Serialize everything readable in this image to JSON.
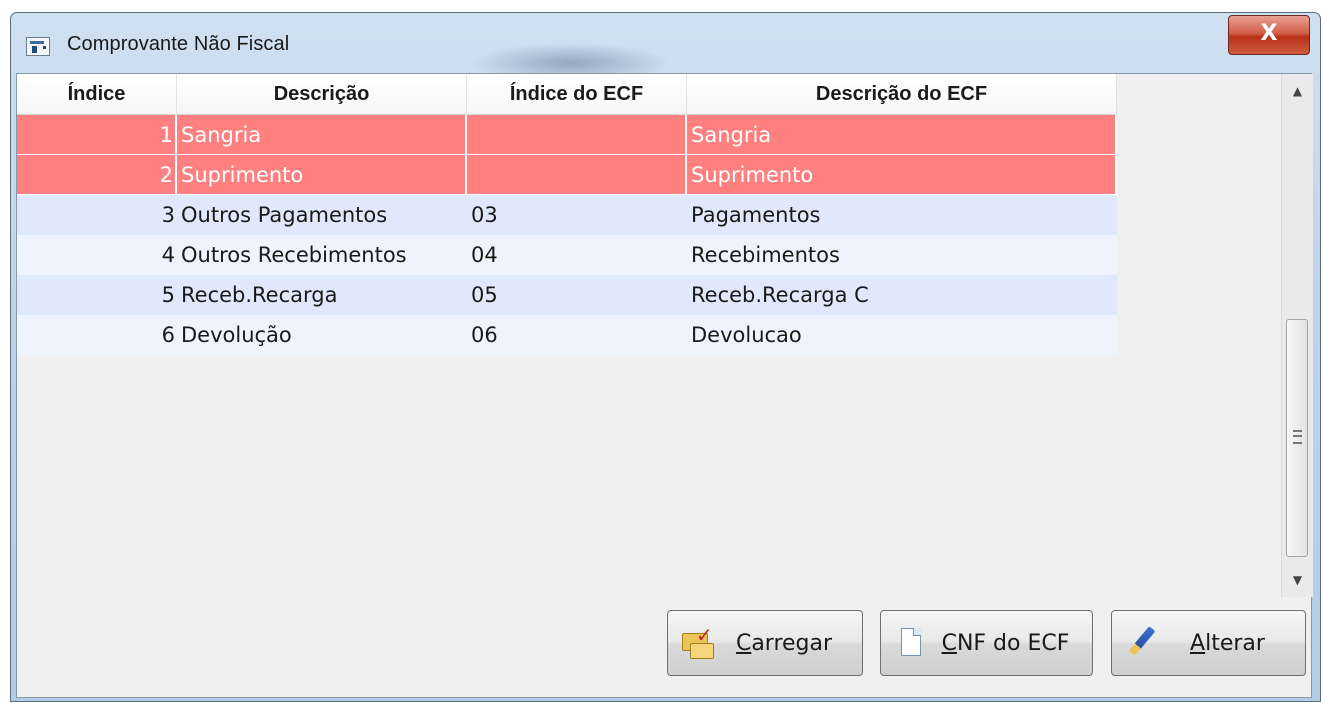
{
  "window": {
    "title": "Comprovante Não Fiscal",
    "close_glyph": "X"
  },
  "grid": {
    "columns": [
      "Índice",
      "Descrição",
      "Índice do ECF",
      "Descrição do ECF"
    ],
    "rows": [
      {
        "indice": "1",
        "descricao": "Sangria",
        "indice_ecf": "",
        "descricao_ecf": "Sangria"
      },
      {
        "indice": "2",
        "descricao": "Suprimento",
        "indice_ecf": "",
        "descricao_ecf": "Suprimento"
      },
      {
        "indice": "3",
        "descricao": "Outros Pagamentos",
        "indice_ecf": "03",
        "descricao_ecf": "Pagamentos"
      },
      {
        "indice": "4",
        "descricao": "Outros Recebimentos",
        "indice_ecf": "04",
        "descricao_ecf": "Recebimentos"
      },
      {
        "indice": "5",
        "descricao": "Receb.Recarga",
        "indice_ecf": "05",
        "descricao_ecf": "Receb.Recarga C"
      },
      {
        "indice": "6",
        "descricao": "Devolução",
        "indice_ecf": "06",
        "descricao_ecf": "Devolucao"
      }
    ],
    "highlight_color": "#ff8080"
  },
  "buttons": {
    "load": {
      "mnemonic": "C",
      "rest": "arregar",
      "icon": "folder-check-icon"
    },
    "cnf": {
      "mnemonic": "C",
      "rest": "NF do ECF",
      "icon": "document-icon"
    },
    "edit": {
      "mnemonic": "A",
      "rest": "lterar",
      "icon": "pen-icon"
    }
  }
}
